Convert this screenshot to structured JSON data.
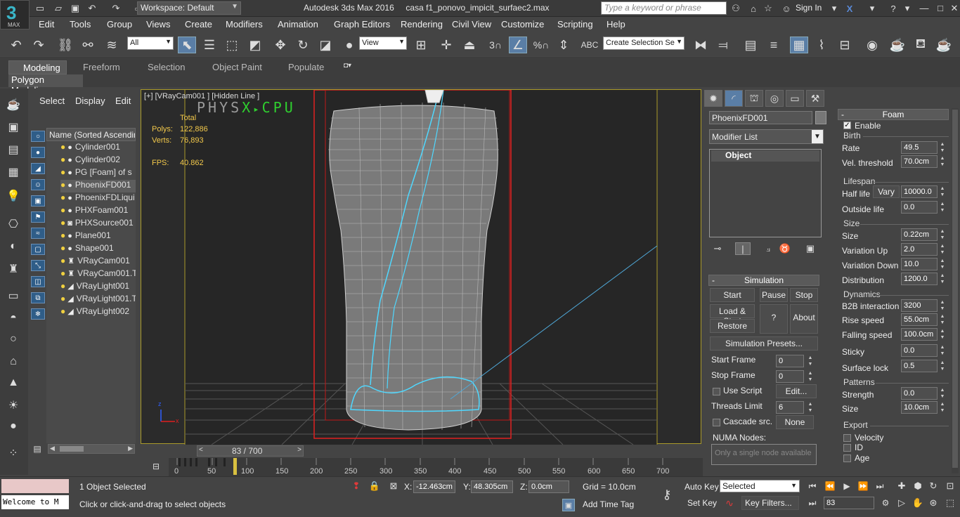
{
  "title_bar": {
    "logo_text": "MAX",
    "workspace": "Workspace: Default",
    "app_title": "Autodesk 3ds Max 2016",
    "file_name": "casa f1_ponovo_impicit_surfaec2.max",
    "search_placeholder": "Type a keyword or phrase",
    "sign_in": "Sign In"
  },
  "menu": [
    "Edit",
    "Tools",
    "Group",
    "Views",
    "Create",
    "Modifiers",
    "Animation",
    "Graph Editors",
    "Rendering",
    "Civil View",
    "Customize",
    "Scripting",
    "Help"
  ],
  "toolbar": {
    "selection_filter": "All",
    "ref_coord": "View",
    "named_selection": "Create Selection Se",
    "snap_label": "3"
  },
  "ribbon": {
    "tabs": [
      "Modeling",
      "Freeform",
      "Selection",
      "Object Paint",
      "Populate"
    ],
    "panel_label": "Polygon Modeling"
  },
  "explorer": {
    "tabs": [
      "Select",
      "Display",
      "Edit"
    ],
    "column_header": "Name (Sorted Ascending)",
    "items": [
      {
        "name": "Cylinder001",
        "icon": "sphere-dot"
      },
      {
        "name": "Cylinder002",
        "icon": "sphere-dot"
      },
      {
        "name": "PG [Foam] of s",
        "icon": "sphere-dot"
      },
      {
        "name": "PhoenixFD001",
        "icon": "sphere-dot"
      },
      {
        "name": "PhoenixFDLiqui",
        "icon": "sphere-dot"
      },
      {
        "name": "PHXFoam001",
        "icon": "sphere-dot"
      },
      {
        "name": "PHXSource001",
        "icon": "source-icon"
      },
      {
        "name": "Plane001",
        "icon": "sphere-dot"
      },
      {
        "name": "Shape001",
        "icon": "sphere-dot"
      },
      {
        "name": "VRayCam001",
        "icon": "camera-icon"
      },
      {
        "name": "VRayCam001.T",
        "icon": "camera-icon"
      },
      {
        "name": "VRayLight001",
        "icon": "light-icon"
      },
      {
        "name": "VRayLight001.T",
        "icon": "light-icon"
      },
      {
        "name": "VRayLight002",
        "icon": "light-icon"
      }
    ],
    "selected_index": 3
  },
  "viewport": {
    "label": "[+] [VRayCam001 ] [Hidden Line ]",
    "physx_a": "PHYS",
    "physx_b": "X",
    "physx_c": "CPU",
    "stats_total_label": "Total",
    "polys_label": "Polys:",
    "polys_value": "122,886",
    "verts_label": "Verts:",
    "verts_value": "76,893",
    "fps_label": "FPS:",
    "fps_value": "40.862",
    "time_slider": "83 / 700",
    "time_slider_fraction": 0.1186,
    "axis_z": "z",
    "axis_x": "x",
    "ticks": [
      "0",
      "50",
      "100",
      "150",
      "200",
      "250",
      "300",
      "350",
      "400",
      "450",
      "500",
      "550",
      "600",
      "650",
      "700"
    ]
  },
  "status": {
    "maxscript_input": "Welcome to M",
    "objects_selected": "1 Object Selected",
    "prompt": "Click or click-and-drag to select objects",
    "x_label": "X:",
    "x_value": "-12.463cm",
    "y_label": "Y:",
    "y_value": "48.305cm",
    "z_label": "Z:",
    "z_value": "0.0cm",
    "grid": "Grid = 10.0cm",
    "add_time_tag": "Add Time Tag",
    "auto_key": "Auto Key",
    "set_key": "Set Key",
    "key_mode": "Selected",
    "key_filters": "Key Filters...",
    "current_frame": "83"
  },
  "command_panel": {
    "object_name": "PhoenixFD001",
    "modifier_list": "Modifier List",
    "stack_item": "Object",
    "simulation": {
      "title": "Simulation",
      "start": "Start",
      "pause": "Pause",
      "stop": "Stop",
      "load_start": "Load & Start",
      "help": "?",
      "restore": "Restore",
      "about": "About",
      "presets": "Simulation Presets...",
      "start_frame_label": "Start Frame",
      "start_frame": "0",
      "stop_frame_label": "Stop Frame",
      "stop_frame": "0",
      "use_script": "Use Script",
      "edit": "Edit...",
      "threads_label": "Threads Limit",
      "threads": "6",
      "cascade": "Cascade src.",
      "cascade_value": "None",
      "numa_label": "NUMA Nodes:",
      "numa_value": "Only a single node available"
    },
    "foam": {
      "title": "Foam",
      "enable": "Enable",
      "birth_group": "Birth",
      "rate_label": "Rate",
      "rate": "49.5",
      "vel_threshold_label": "Vel. threshold",
      "vel_threshold": "70.0cm",
      "lifespan_group": "Lifespan",
      "half_life_label": "Half life",
      "vary_label": "Vary",
      "half_life": "10000.0",
      "outside_life_label": "Outside life",
      "outside_life": "0.0",
      "size_group": "Size",
      "size_label": "Size",
      "size": "0.22cm",
      "variation_up_label": "Variation Up",
      "variation_up": "2.0",
      "variation_down_label": "Variation Down",
      "variation_down": "10.0",
      "distribution_label": "Distribution",
      "distribution": "1200.0",
      "dynamics_group": "Dynamics",
      "b2b_label": "B2B interaction",
      "b2b": "3200",
      "rise_label": "Rise speed",
      "rise": "55.0cm",
      "falling_label": "Falling speed",
      "falling": "100.0cm",
      "sticky_label": "Sticky",
      "sticky": "0.0",
      "surface_lock_label": "Surface lock",
      "surface_lock": "0.5",
      "patterns_group": "Patterns",
      "strength_label": "Strength",
      "strength": "0.0",
      "pattern_size_label": "Size",
      "pattern_size": "10.0cm",
      "export_group": "Export",
      "velocity": "Velocity",
      "id": "ID",
      "age": "Age"
    }
  },
  "colors": {
    "accent_blue": "#5a7ea6",
    "physx_green": "#2fd02f",
    "physx_gray": "#9a9a9a",
    "stats_yellow": "#f2c84b",
    "viewport_border": "#aa9a2a",
    "wire_gray": "#d0d0d0",
    "liquid_cyan": "#4fd8ff",
    "bbox_red": "#e02020"
  }
}
